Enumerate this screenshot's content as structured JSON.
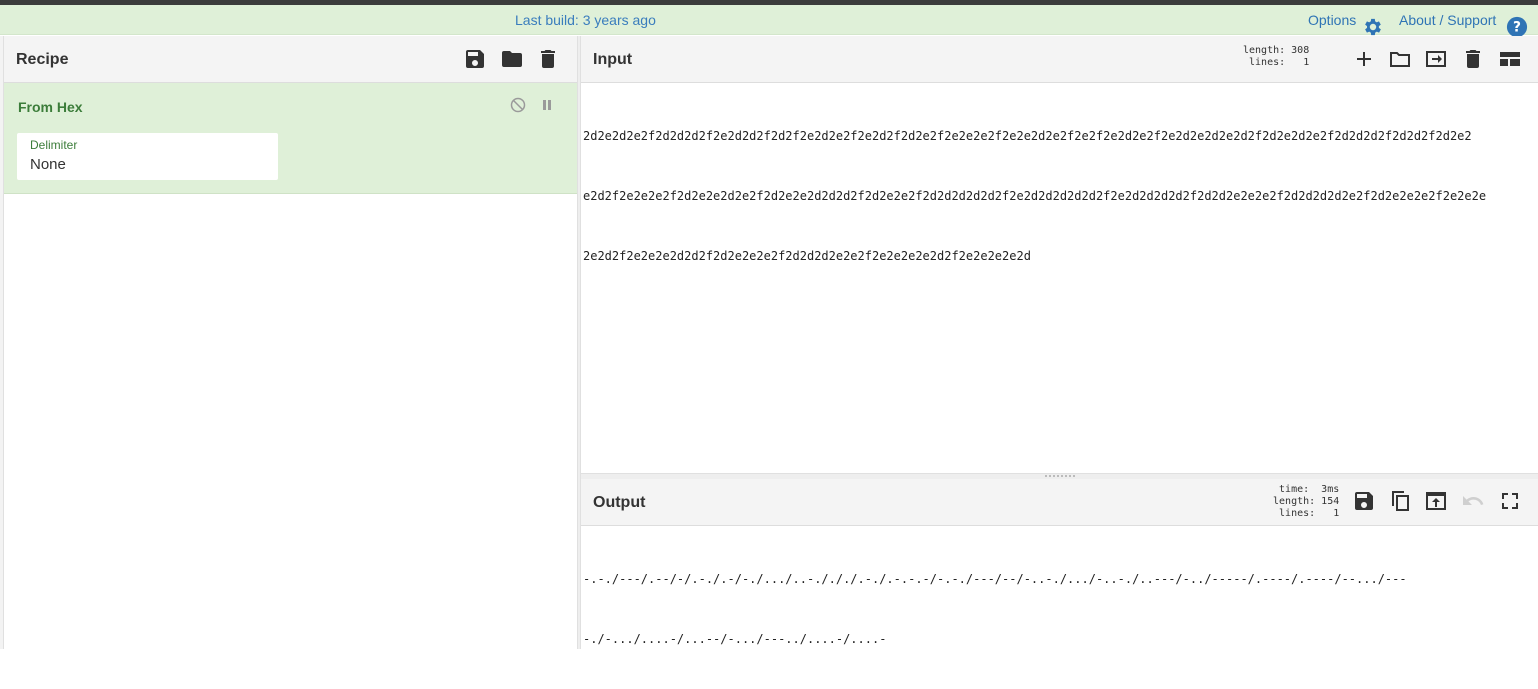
{
  "banner": {
    "last_build": "Last build: 3 years ago",
    "options_label": "Options",
    "about_label": "About / Support"
  },
  "recipe": {
    "title": "Recipe",
    "operation": {
      "name": "From Hex",
      "delimiter_label": "Delimiter",
      "delimiter_value": "None"
    }
  },
  "input": {
    "title": "Input",
    "stats": "length: 308\n lines:   1",
    "lines": [
      "2d2e2d2e2f2d2d2d2f2e2d2d2f2d2f2e2d2e2f2e2d2f2d2e2f2e2e2e2f2e2e2d2e2f2e2f2e2d2e2f2e2d2e2d2e2d2f2d2e2d2e2f2d2d2d2f2d2d2f2d2e2",
      "e2d2f2e2e2e2f2d2e2e2d2e2f2d2e2e2d2d2d2f2d2e2e2f2d2d2d2d2d2f2e2d2d2d2d2d2f2e2d2d2d2d2f2d2d2e2e2e2f2d2d2d2d2e2f2d2e2e2e2f2e2e2e",
      "2e2d2f2e2e2e2d2d2f2d2e2e2e2f2d2d2d2e2e2f2e2e2e2e2d2f2e2e2e2e2d"
    ]
  },
  "output": {
    "title": "Output",
    "stats": "  time:  3ms\nlength: 154\n lines:   1",
    "lines": [
      "-.-./---/.--/-/.-./.-/-./.../..-./././.-./.-.-.-/-.-./---/--/-..-./.../-..-./..---/-../-----/.----/.----/--.../---",
      "-./-.../....-/...--/-.../---../....-/....-"
    ]
  },
  "colors": {
    "banner_bg": "#dff0d8",
    "link_blue": "#2f74b5",
    "op_green_text": "#3c7d3a",
    "header_bg": "#f4f4f4"
  }
}
